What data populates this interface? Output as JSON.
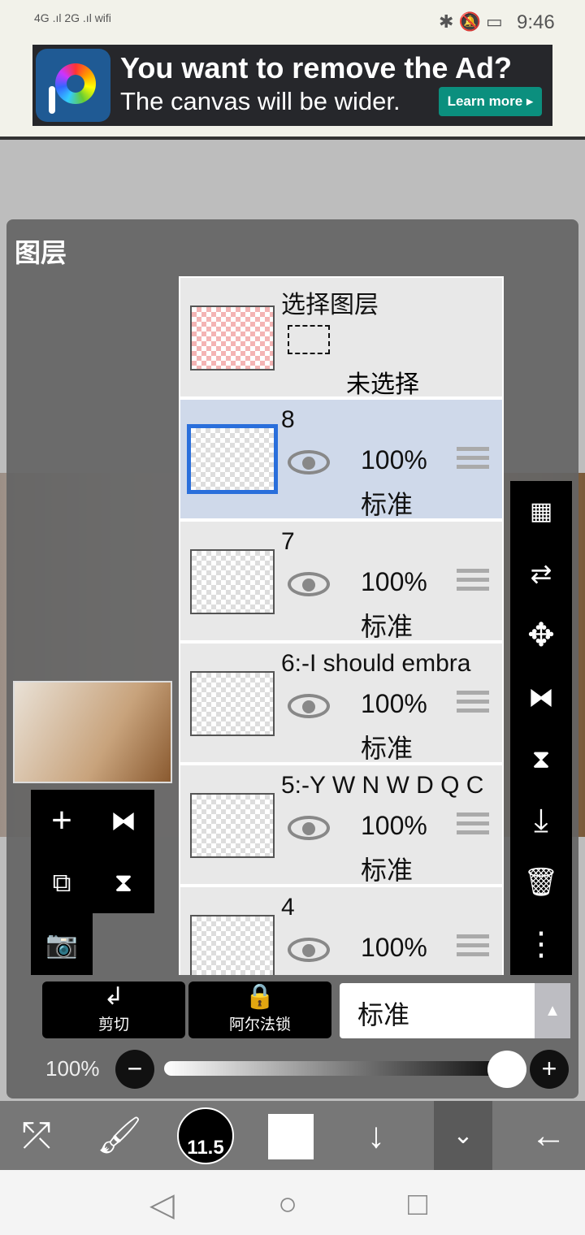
{
  "status": {
    "left": "4G .ıl 2G .ıl wifi",
    "time": "9:46"
  },
  "ad": {
    "title": "You want to remove the Ad?",
    "subtitle": "The canvas will be wider.",
    "cta": "Learn more ▸"
  },
  "panel": {
    "title": "图层"
  },
  "select_layer": {
    "title": "选择图层",
    "state": "未选择"
  },
  "layers": [
    {
      "name": "8",
      "opacity": "100%",
      "mode": "标准",
      "selected": true
    },
    {
      "name": "7",
      "opacity": "100%",
      "mode": "标准"
    },
    {
      "name": "6:-I should embra",
      "opacity": "100%",
      "mode": "标准"
    },
    {
      "name": "5:-Y W N W D Q C",
      "opacity": "100%",
      "mode": "标准"
    },
    {
      "name": "4",
      "opacity": "100%",
      "mode": ""
    }
  ],
  "bottom": {
    "clip": "剪切",
    "alpha_lock": "阿尔法锁",
    "blend_mode": "标准",
    "opacity": "100%",
    "opacity_value": 1.0
  },
  "toolbar": {
    "brush_size": "11.5"
  }
}
